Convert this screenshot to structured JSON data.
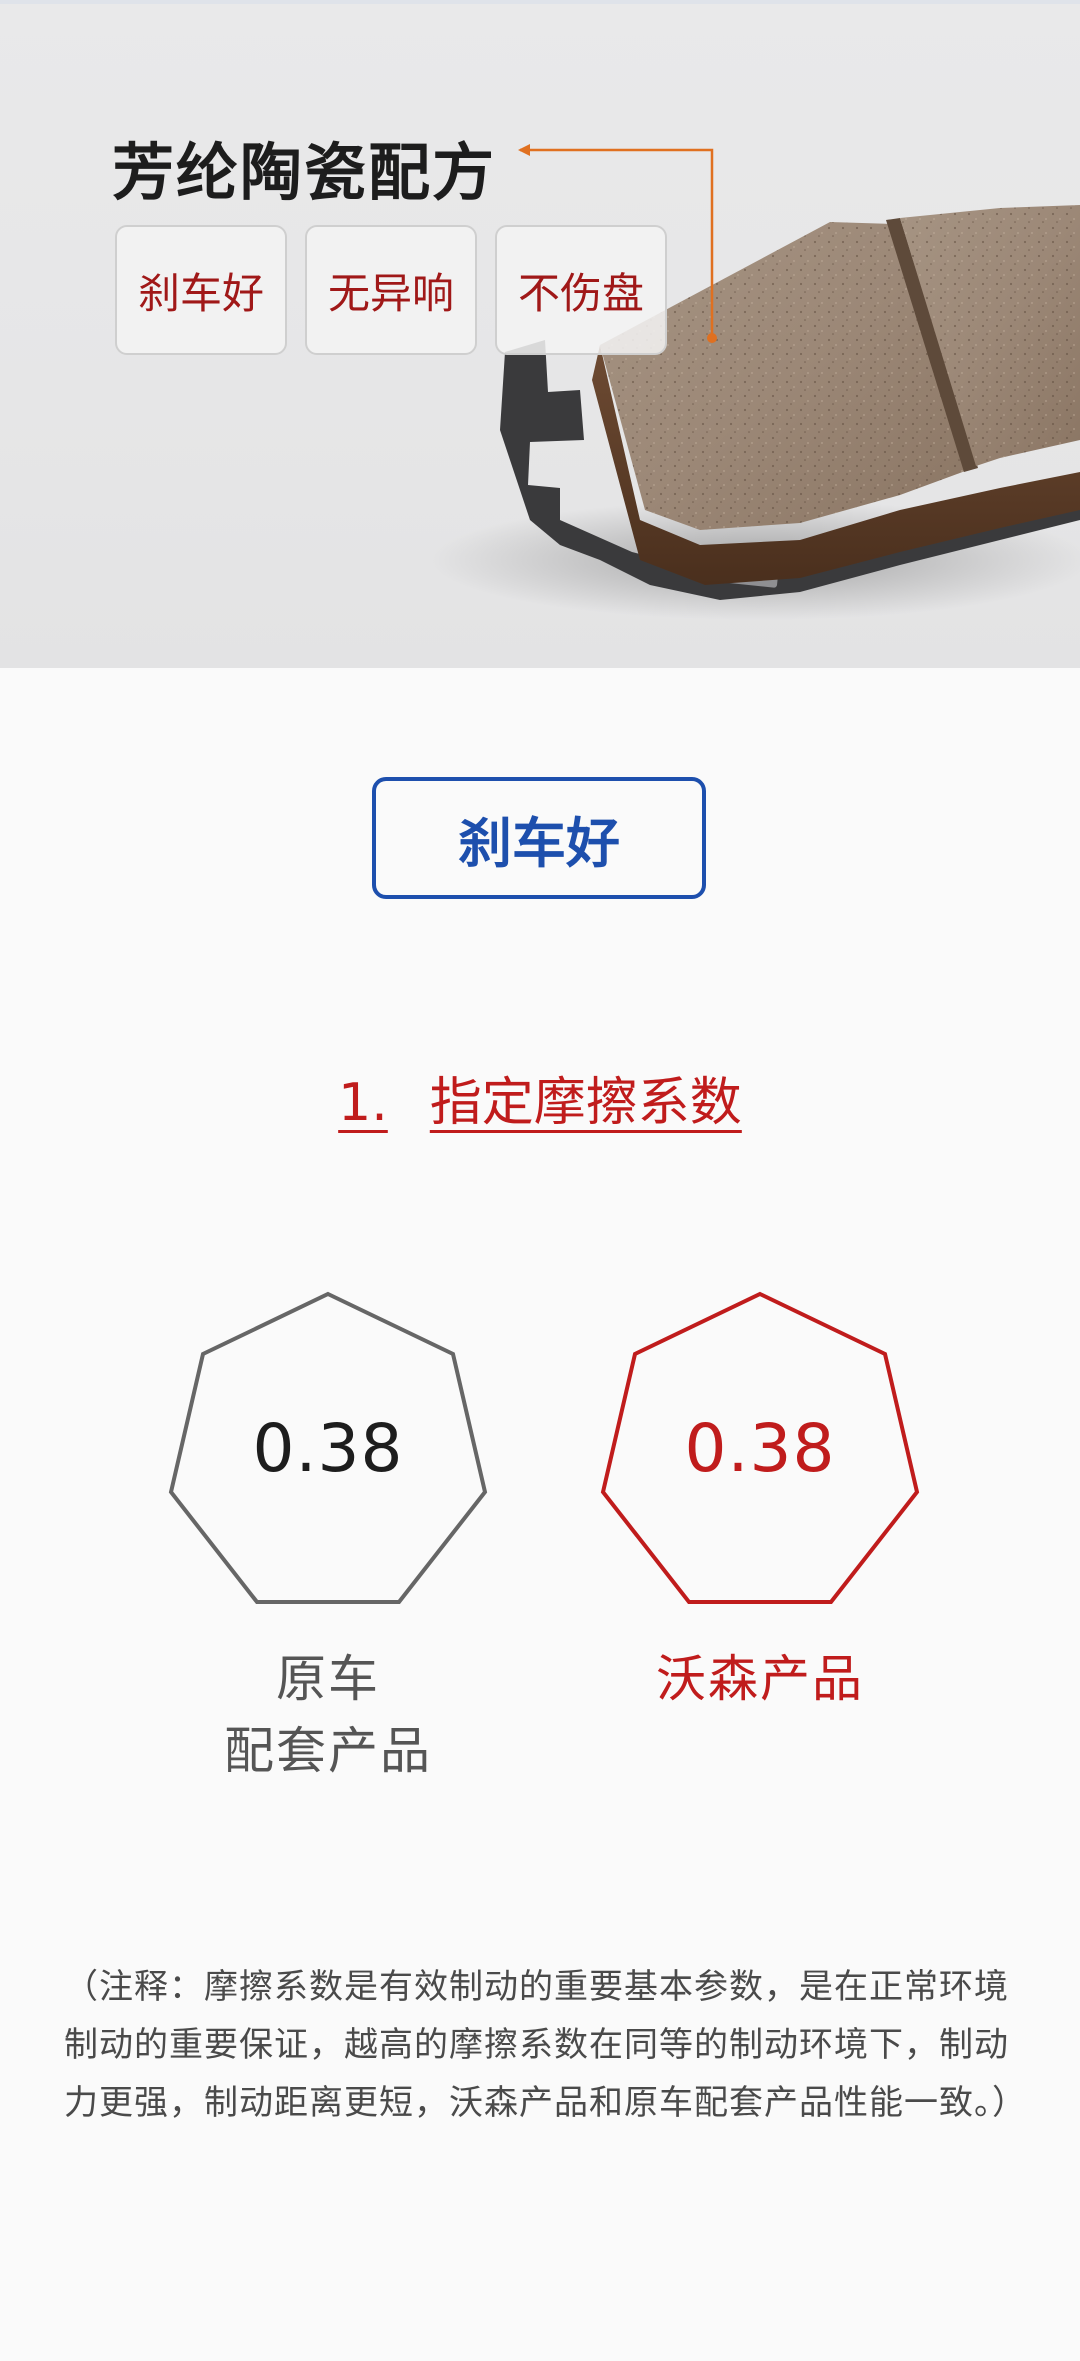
{
  "hero": {
    "title": "芳纶陶瓷配方",
    "tags": [
      "刹车好",
      "无异响",
      "不伤盘"
    ],
    "colors": {
      "tag_text": "#a01818",
      "callout_line": "#e07020"
    }
  },
  "section": {
    "badge": "刹车好",
    "heading_number": "1.",
    "heading_text": "指定摩擦系数",
    "colors": {
      "badge": "#1d4fad",
      "heading": "#c01c1c"
    }
  },
  "comparison": [
    {
      "value": "0.38",
      "label_line1": "原车",
      "label_line2": "配套产品",
      "color": "#666666"
    },
    {
      "value": "0.38",
      "label_line1": "沃森产品",
      "label_line2": "",
      "color": "#c01c1c"
    }
  ],
  "note": {
    "line1": "（注释：摩擦系数是有效制动的重要基本参数，是在正常环境",
    "line2": "制动的重要保证，越高的摩擦系数在同等的制动环境下，制动",
    "line3": "力更强，制动距离更短，沃森产品和原车配套产品性能一致。）"
  }
}
